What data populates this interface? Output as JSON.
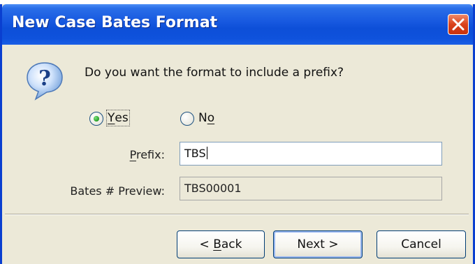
{
  "window": {
    "title": "New Case Bates Format"
  },
  "dialog": {
    "question": "Do you want the format to include a prefix?",
    "options": {
      "yes": {
        "mnemonic": "Y",
        "rest": "es",
        "selected": true
      },
      "no": {
        "first": "N",
        "mnemonic": "o",
        "selected": false
      }
    },
    "prefix": {
      "mnemonic": "P",
      "rest": "refix:",
      "value": "TBS"
    },
    "preview": {
      "label": "Bates # Preview:",
      "value": "TBS00001"
    }
  },
  "buttons": {
    "back": {
      "arrow": "< ",
      "mnemonic": "B",
      "rest": "ack"
    },
    "next": {
      "label": "Next >"
    },
    "cancel": {
      "label": "Cancel"
    }
  },
  "icons": {
    "question": "question-icon",
    "close": "close-icon"
  },
  "colors": {
    "titlebar": "#0d4fd8",
    "close": "#d9411b",
    "dialog_bg": "#ece9d8"
  }
}
